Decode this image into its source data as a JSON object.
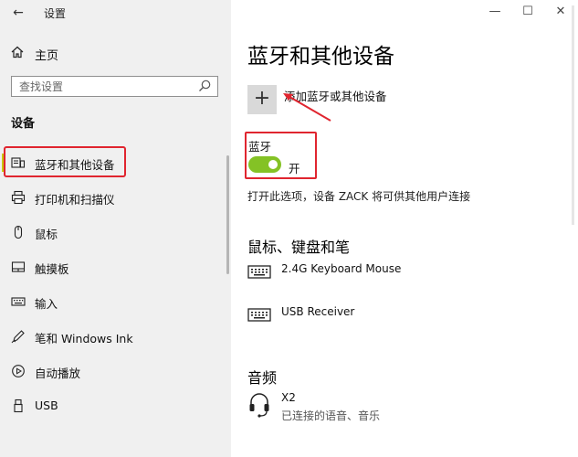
{
  "window": {
    "title": "设置",
    "back_glyph": "←",
    "minimize_glyph": "—",
    "maximize_glyph": "☐",
    "close_glyph": "✕"
  },
  "sidebar": {
    "home_label": "主页",
    "search_placeholder": "查找设置",
    "section_label": "设备",
    "items": [
      {
        "label": "蓝牙和其他设备",
        "icon": "bluetooth-devices-icon",
        "active": true
      },
      {
        "label": "打印机和扫描仪",
        "icon": "printer-icon"
      },
      {
        "label": "鼠标",
        "icon": "mouse-icon"
      },
      {
        "label": "触摸板",
        "icon": "touchpad-icon"
      },
      {
        "label": "输入",
        "icon": "keyboard-icon"
      },
      {
        "label": "笔和 Windows Ink",
        "icon": "pen-icon"
      },
      {
        "label": "自动播放",
        "icon": "autoplay-icon"
      },
      {
        "label": "USB",
        "icon": "usb-icon"
      }
    ]
  },
  "main": {
    "title": "蓝牙和其他设备",
    "add_glyph": "+",
    "add_label": "添加蓝牙或其他设备",
    "bluetooth": {
      "label": "蓝牙",
      "state_label": "开",
      "on": true,
      "description": "打开此选项，设备 ZACK 将可供其他用户连接"
    },
    "sections": [
      {
        "title": "鼠标、键盘和笔",
        "devices": [
          {
            "name": "2.4G Keyboard Mouse",
            "icon": "keyboard-icon"
          },
          {
            "name": "USB Receiver",
            "icon": "keyboard-icon"
          }
        ]
      },
      {
        "title": "音频",
        "devices": [
          {
            "name": "X2",
            "status": "已连接的语音、音乐",
            "icon": "headset-icon"
          }
        ]
      }
    ]
  },
  "colors": {
    "accent_toggle": "#84c225",
    "annotation_red": "#e0252f",
    "active_indicator": "#c8c80a",
    "sidebar_bg": "#f0f0f0"
  }
}
